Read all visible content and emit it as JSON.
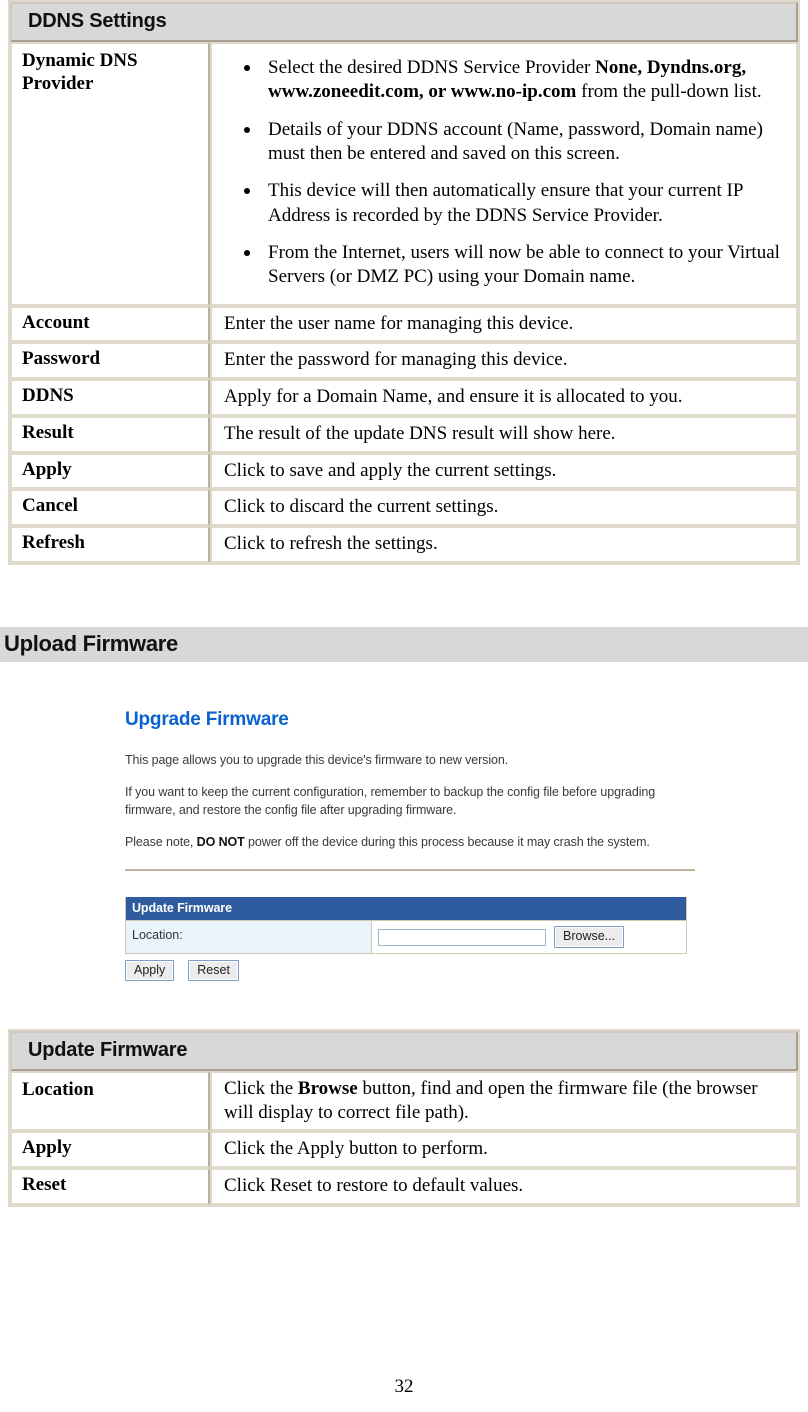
{
  "ddns_table": {
    "header": "DDNS Settings",
    "rows": [
      {
        "key": "Dynamic DNS Provider",
        "bullets": [
          "Select the desired DDNS Service Provider None, Dyndns.org, www.zoneedit.com, or www.no-ip.com from the pull-down list.",
          "Details of your DDNS account (Name, password, Domain name) must then be entered and saved on this screen.",
          "This device will then automatically ensure that your current IP Address is recorded by the DDNS Service Provider.",
          "From the Internet, users will now be able to connect to your Virtual Servers (or DMZ PC) using your Domain name."
        ]
      },
      {
        "key": "Account",
        "value": "Enter the user name for managing this device."
      },
      {
        "key": "Password",
        "value": "Enter the password for managing this device."
      },
      {
        "key": "DDNS",
        "value": "Apply for a Domain Name, and ensure it is allocated to you."
      },
      {
        "key": "Result",
        "value": "The result of the update DNS result will show here."
      },
      {
        "key": "Apply",
        "value": "Click to save and apply the current settings."
      },
      {
        "key": "Cancel",
        "value": "Click to discard the current settings."
      },
      {
        "key": "Refresh",
        "value": "Click to refresh the settings."
      }
    ]
  },
  "upload_section": {
    "heading": "Upload Firmware"
  },
  "screenshot": {
    "title": "Upgrade Firmware",
    "paragraph1": "This page allows you to upgrade this device's firmware to new version.",
    "paragraph2": "If you want to keep the current configuration, remember to backup the config file before upgrading firmware, and restore the config file after upgrading firmware.",
    "paragraph3_pre": "Please note, ",
    "paragraph3_bold": "DO NOT",
    "paragraph3_post": " power off the device during this process because it may crash the system.",
    "panel_title": "Update Firmware",
    "location_label": "Location:",
    "location_value": "",
    "location_placeholder": "",
    "browse_button": "Browse...",
    "apply_button": "Apply",
    "reset_button": "Reset",
    "colors": {
      "title_blue": "#0A62D0",
      "panel_blue": "#2F5C9E",
      "label_bg": "#E9F4FB"
    }
  },
  "update_table": {
    "header": "Update Firmware",
    "rows": [
      {
        "key": "Location",
        "value": "Click the Browse button, find and open the firmware file (the browser will display to correct file path)."
      },
      {
        "key": "Apply",
        "value": "Click the Apply button to perform."
      },
      {
        "key": "Reset",
        "value": "Click Reset to restore to default values."
      }
    ]
  },
  "footer": {
    "page_number": "32"
  }
}
